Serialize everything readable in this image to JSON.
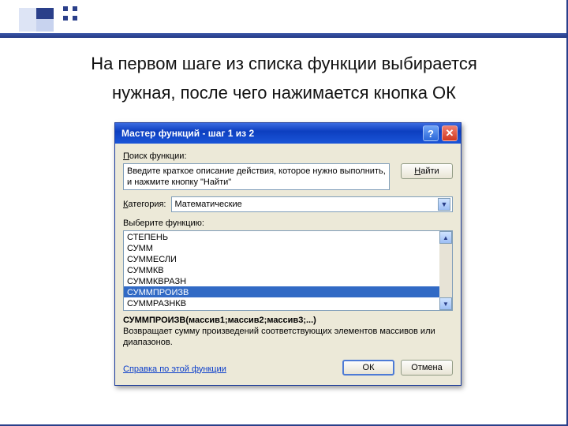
{
  "caption_line1": "На первом шаге из списка функции выбирается",
  "caption_line2": "нужная, после чего нажимается кнопка ОК",
  "dialog": {
    "title": "Мастер функций - шаг 1 из 2",
    "search_label": "Поиск функции:",
    "search_text": "Введите краткое описание действия, которое нужно выполнить, и нажмите кнопку \"Найти\"",
    "find_btn": "Найти",
    "category_label": "Категория:",
    "category_value": "Математические",
    "select_label": "Выберите функцию:",
    "functions": [
      "СТЕПЕНЬ",
      "СУММ",
      "СУММЕСЛИ",
      "СУММКВ",
      "СУММКВРАЗН",
      "СУММПРОИЗВ",
      "СУММРАЗНКВ"
    ],
    "selected_index": 5,
    "syntax": "СУММПРОИЗВ(массив1;массив2;массив3;...)",
    "description": "Возвращает сумму произведений соответствующих элементов массивов или диапазонов.",
    "help_link": "Справка по этой функции",
    "ok_btn": "ОК",
    "cancel_btn": "Отмена"
  }
}
